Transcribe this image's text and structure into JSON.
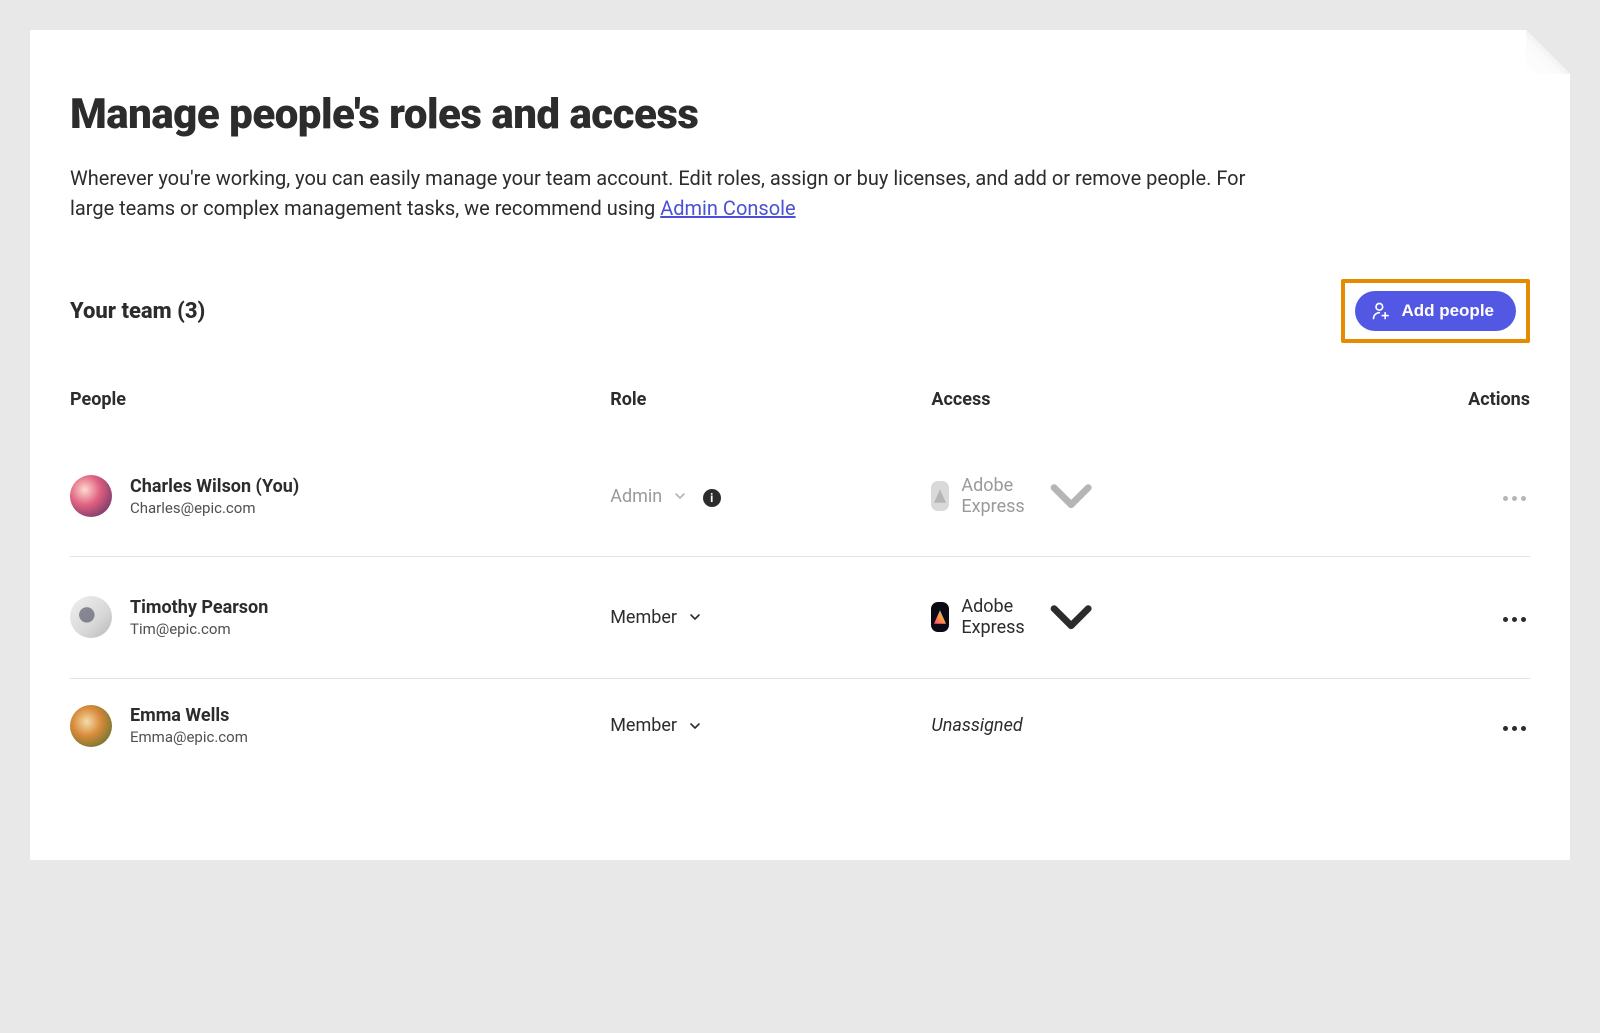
{
  "header": {
    "title": "Manage people's roles and access",
    "description_before_link": "Wherever you're working, you can easily manage your team account. Edit roles, assign or buy licenses, and add or remove people. For large teams or complex management tasks, we recommend using ",
    "link_text": "Admin Console"
  },
  "team": {
    "title": "Your team (3)",
    "count": 3,
    "add_button": "Add people"
  },
  "columns": {
    "people": "People",
    "role": "Role",
    "access": "Access",
    "actions": "Actions"
  },
  "rows": [
    {
      "name": "Charles Wilson (You)",
      "email": "Charles@epic.com",
      "role": "Admin",
      "role_muted": true,
      "has_info": true,
      "access_label": "Adobe Express",
      "access_type": "app",
      "access_muted": true,
      "actions_muted": true
    },
    {
      "name": "Timothy Pearson",
      "email": "Tim@epic.com",
      "role": "Member",
      "role_muted": false,
      "has_info": false,
      "access_label": "Adobe Express",
      "access_type": "app",
      "access_muted": false,
      "actions_muted": false
    },
    {
      "name": "Emma Wells",
      "email": "Emma@epic.com",
      "role": "Member",
      "role_muted": false,
      "has_info": false,
      "access_label": "Unassigned",
      "access_type": "unassigned",
      "access_muted": false,
      "actions_muted": false
    }
  ]
}
